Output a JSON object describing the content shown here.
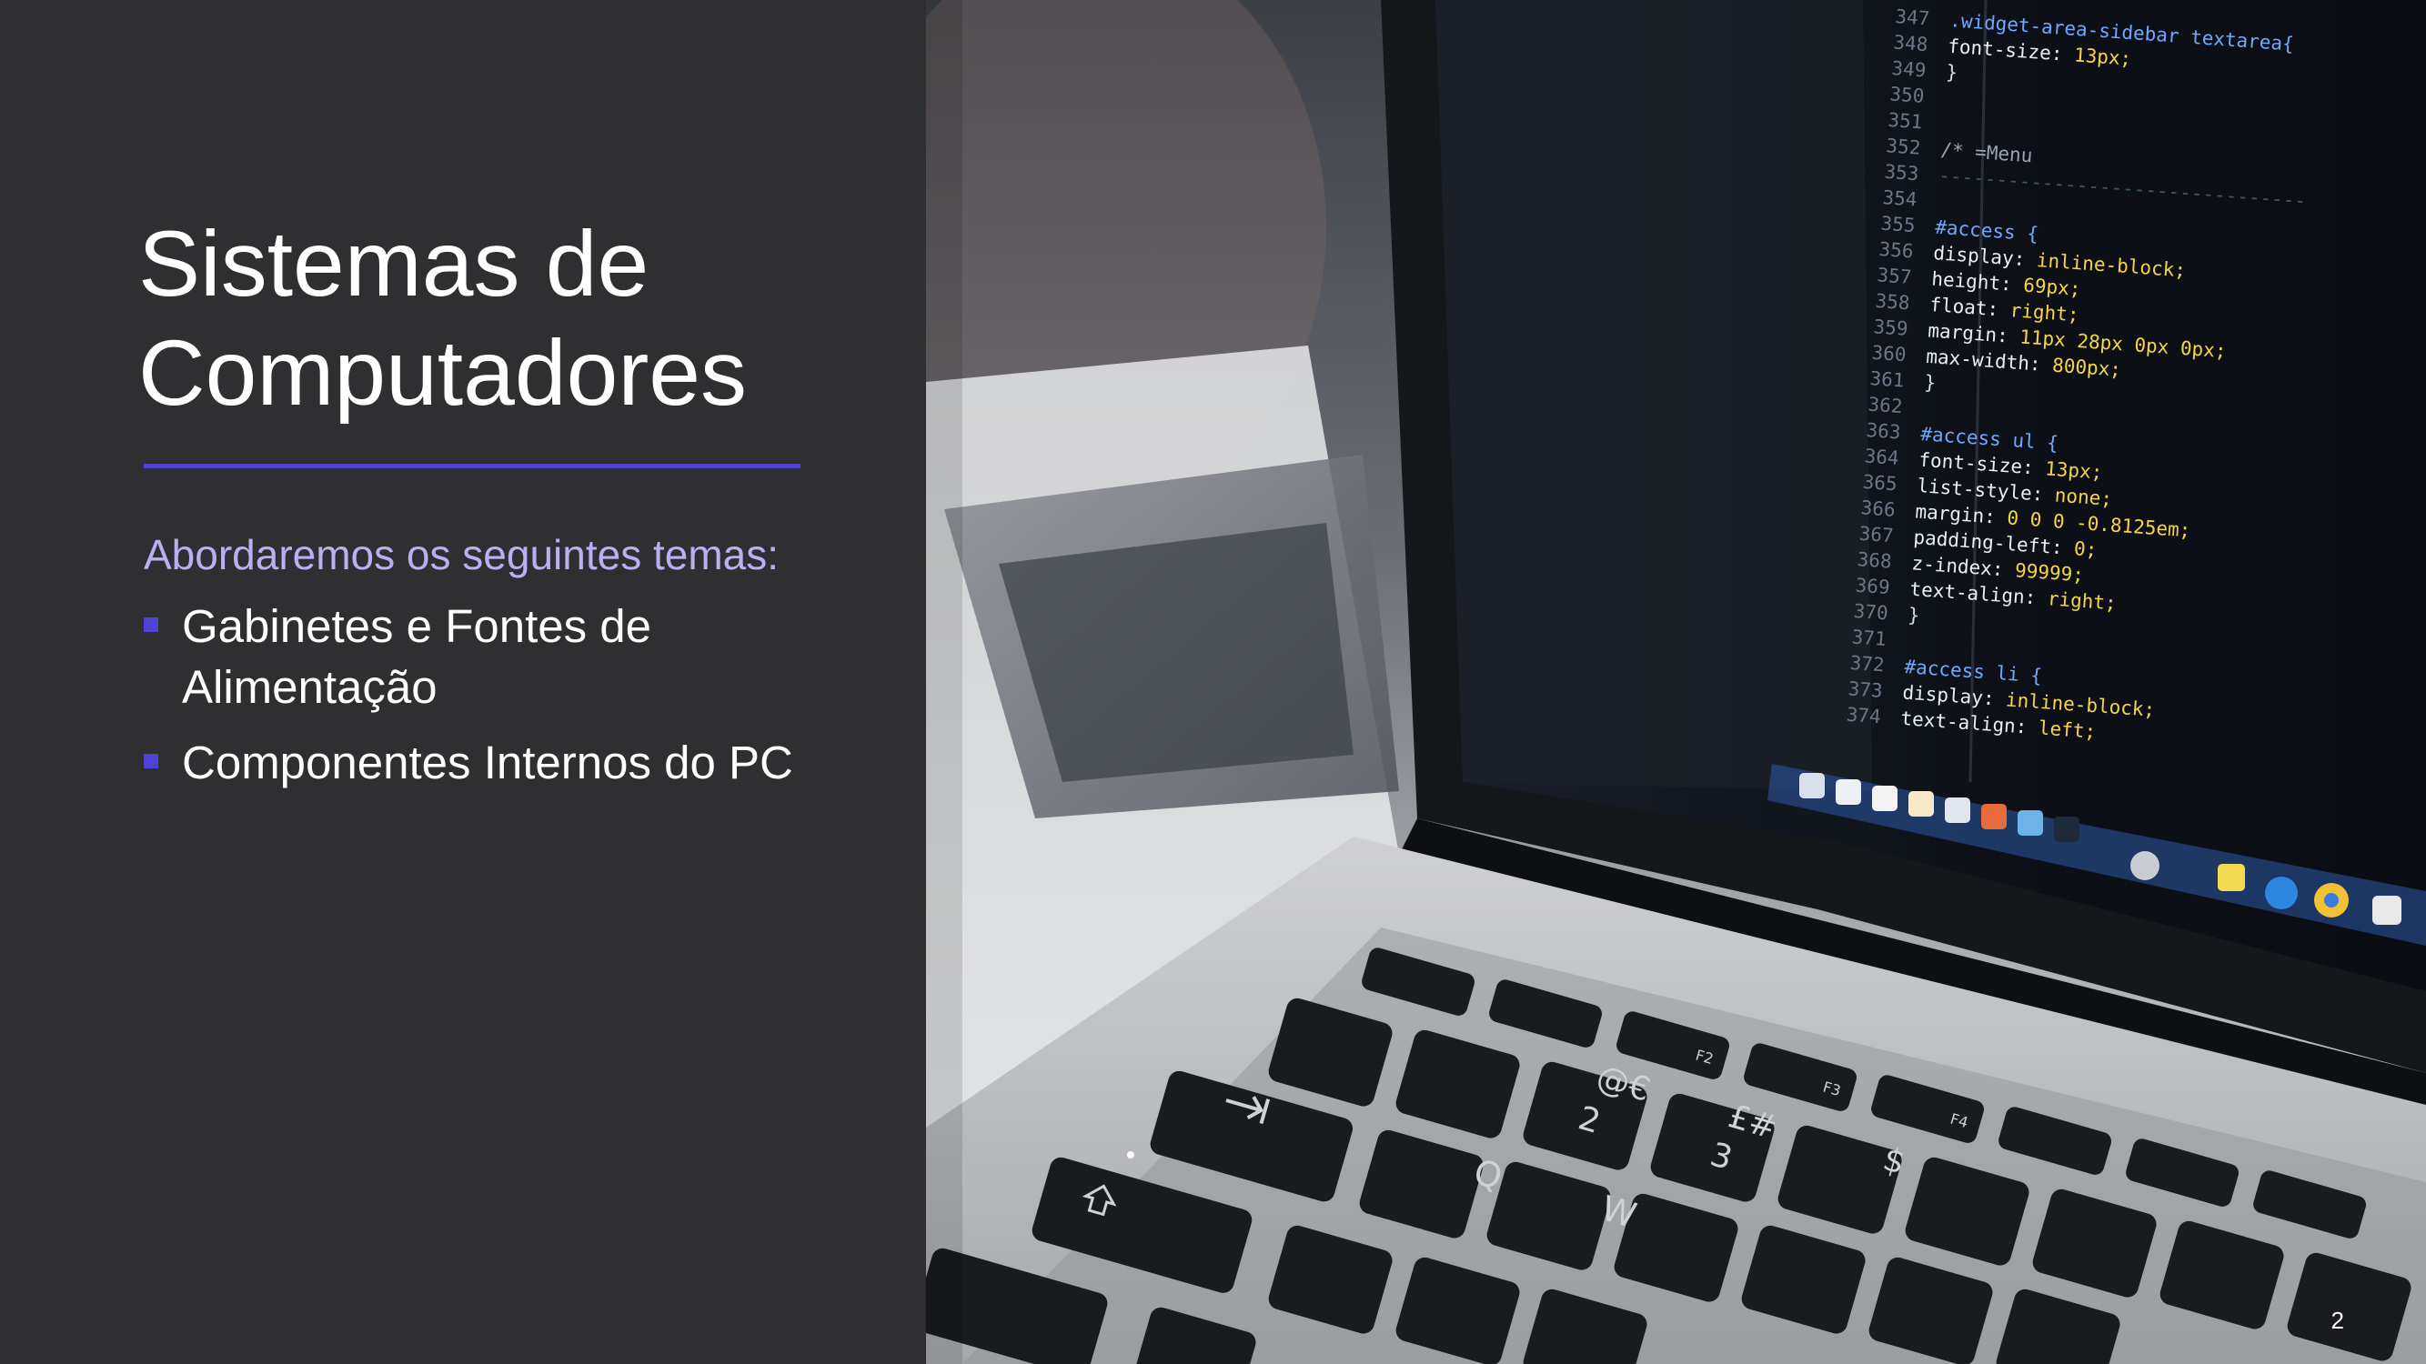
{
  "slide": {
    "title": "Sistemas de Computadores",
    "subtitle": "Abordaremos os seguintes temas:",
    "bullets": [
      "Gabinetes e Fontes de Alimentação",
      "Componentes Internos do PC"
    ],
    "page_number": "2"
  },
  "photo": {
    "description_icon": "laptop-photo",
    "code_lines": [
      {
        "num": "347",
        "text": ".widget-area-sidebar  textarea{"
      },
      {
        "num": "348",
        "text": "    font-size: 13px;"
      },
      {
        "num": "349",
        "text": "}"
      },
      {
        "num": "350",
        "text": ""
      },
      {
        "num": "351",
        "text": ""
      },
      {
        "num": "352",
        "text": "/* =Menu"
      },
      {
        "num": "353",
        "text": "--------------------------------"
      },
      {
        "num": "354",
        "text": ""
      },
      {
        "num": "355",
        "text": "#access {"
      },
      {
        "num": "356",
        "text": "    display: inline-block;"
      },
      {
        "num": "357",
        "text": "    height: 69px;"
      },
      {
        "num": "358",
        "text": "    float: right;"
      },
      {
        "num": "359",
        "text": "    margin: 11px 28px 0px 0px;"
      },
      {
        "num": "360",
        "text": "    max-width: 800px;"
      },
      {
        "num": "361",
        "text": "}"
      },
      {
        "num": "362",
        "text": ""
      },
      {
        "num": "363",
        "text": "#access ul {"
      },
      {
        "num": "364",
        "text": "    font-size: 13px;"
      },
      {
        "num": "365",
        "text": "    list-style: none;"
      },
      {
        "num": "366",
        "text": "    margin: 0 0 0 -0.8125em;"
      },
      {
        "num": "367",
        "text": "    padding-left: 0;"
      },
      {
        "num": "368",
        "text": "    z-index: 99999;"
      },
      {
        "num": "369",
        "text": "    text-align: right;"
      },
      {
        "num": "370",
        "text": "}"
      },
      {
        "num": "371",
        "text": ""
      },
      {
        "num": "372",
        "text": "#access li {"
      },
      {
        "num": "373",
        "text": "    display: inline-block;"
      },
      {
        "num": "374",
        "text": "    text-align: left;"
      }
    ],
    "keys": {
      "q": "Q",
      "w": "W",
      "two": "2",
      "two_alt": "@€",
      "three": "3",
      "three_alt": "£#",
      "four": "$",
      "f2": "F2",
      "f3": "F3",
      "f4": "F4"
    }
  },
  "colors": {
    "background": "#2f2f31",
    "accent": "#4e43d4",
    "subtitle": "#b9b0f2",
    "text": "#ffffff"
  }
}
